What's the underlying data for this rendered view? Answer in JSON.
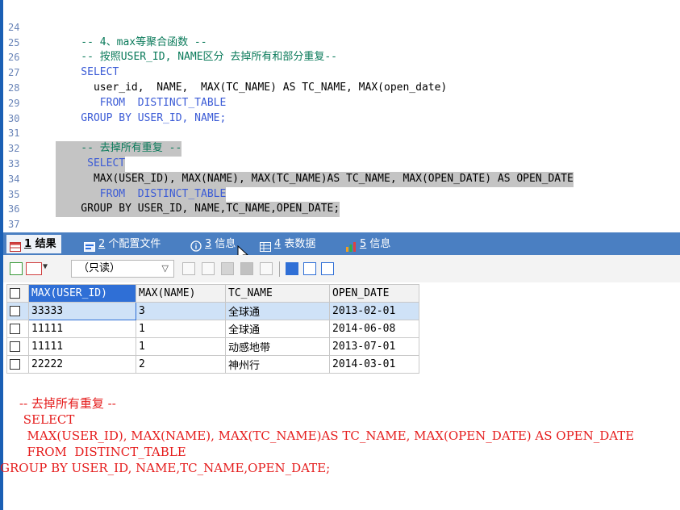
{
  "editor": {
    "lines": [
      {
        "n": "24",
        "code": "    -- 4、max等聚合函数 --"
      },
      {
        "n": "25",
        "code": "    -- 按照USER_ID, NAME区分 去掉所有和部分重复--"
      },
      {
        "n": "26",
        "code": "    SELECT"
      },
      {
        "n": "27",
        "code": "      user_id,  NAME,  MAX(TC_NAME) AS TC_NAME, MAX(open_date)"
      },
      {
        "n": "28",
        "code": "       FROM  DISTINCT_TABLE"
      },
      {
        "n": "29",
        "code": "    GROUP BY USER_ID, NAME;"
      },
      {
        "n": "30",
        "code": ""
      },
      {
        "n": "31",
        "code": "    -- 去掉所有重复 --"
      },
      {
        "n": "32",
        "code": "     SELECT"
      },
      {
        "n": "33",
        "code": "      MAX(USER_ID), MAX(NAME), MAX(TC_NAME)AS TC_NAME, MAX(OPEN_DATE) AS OPEN_DATE"
      },
      {
        "n": "34",
        "code": "       FROM  DISTINCT_TABLE"
      },
      {
        "n": "35",
        "code": "    GROUP BY USER_ID, NAME,TC_NAME,OPEN_DATE;"
      },
      {
        "n": "36",
        "code": ""
      },
      {
        "n": "37",
        "code": ""
      }
    ]
  },
  "tabs": [
    {
      "num": "1",
      "label": "结果",
      "icon": "result-grid-icon",
      "active": true
    },
    {
      "num": "2",
      "label": "个配置文件",
      "icon": "profile-icon",
      "active": false
    },
    {
      "num": "3",
      "label": "信息",
      "icon": "info-icon",
      "active": false
    },
    {
      "num": "4",
      "label": "表数据",
      "icon": "table-data-icon",
      "active": false
    },
    {
      "num": "5",
      "label": "信息",
      "icon": "chart-info-icon",
      "active": false
    }
  ],
  "toolbar": {
    "mode_select": "（只读）"
  },
  "grid": {
    "columns": [
      "MAX(USER_ID)",
      "MAX(NAME)",
      "TC_NAME",
      "OPEN_DATE"
    ],
    "rows": [
      [
        "33333",
        "3",
        "全球通",
        "2013-02-01"
      ],
      [
        "11111",
        "1",
        "全球通",
        "2014-06-08"
      ],
      [
        "11111",
        "1",
        "动感地带",
        "2013-07-01"
      ],
      [
        "22222",
        "2",
        "神州行",
        "2014-03-01"
      ]
    ]
  },
  "annotation": {
    "lines": [
      "-- 去掉所有重复 --",
      " SELECT",
      "  MAX(USER_ID), MAX(NAME), MAX(TC_NAME)AS TC_NAME, MAX(OPEN_DATE) AS OPEN_DATE",
      "  FROM  DISTINCT_TABLE",
      "GROUP BY USER_ID, NAME,TC_NAME,OPEN_DATE;"
    ]
  },
  "colors": {
    "tabbar": "#4a7fc2",
    "keyword": "#3b5bd6",
    "function": "#d633c9",
    "comment": "#0a7a5a",
    "annotation": "#e51c1c"
  }
}
